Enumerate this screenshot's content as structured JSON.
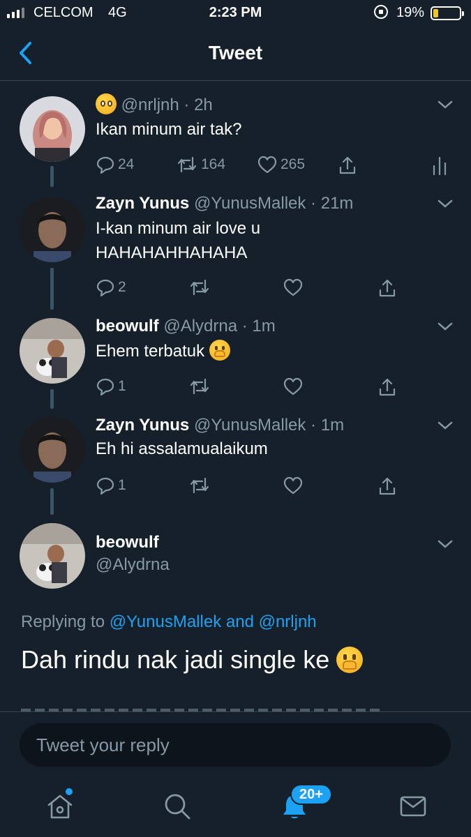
{
  "status_bar": {
    "carrier": "CELCOM",
    "network": "4G",
    "time": "2:23 PM",
    "battery": "19%",
    "battery_level": 0.19
  },
  "nav": {
    "title": "Tweet",
    "back_icon": "chevron-left-icon"
  },
  "tweets": [
    {
      "name": "",
      "handle_emoji": "pleading-face-emoji",
      "handle": "@nrljnh",
      "time": "2h",
      "text": "Ikan minum air tak?",
      "replies": "24",
      "retweets": "164",
      "likes": "265"
    },
    {
      "name": "Zayn Yunus",
      "handle": "@YunusMallek",
      "time": "21m",
      "text_line1": "I-kan minum air love u",
      "text_line2": "HAHAHAHHAHAHA",
      "replies": "2"
    },
    {
      "name": "beowulf",
      "handle": "@Alydrna",
      "time": "1m",
      "text": "Ehem terbatuk",
      "text_emoji": "face-with-hand-over-mouth-emoji",
      "replies": "1"
    },
    {
      "name": "Zayn Yunus",
      "handle": "@YunusMallek",
      "time": "1m",
      "text": "Eh hi assalamualaikum",
      "replies": "1"
    }
  ],
  "main_tweet": {
    "name": "beowulf",
    "handle": "@Alydrna",
    "replying_prefix": "Replying to",
    "reply_user1": "@YunusMallek",
    "reply_and": "and",
    "reply_user2": "@nrljnh",
    "text": "Dah rindu nak jadi single ke",
    "text_emoji": "face-with-hand-over-mouth-emoji"
  },
  "reply_bar": {
    "placeholder": "Tweet your reply"
  },
  "tab_bar": {
    "notifications_badge": "20+",
    "tabs": [
      "home-icon",
      "search-icon",
      "notifications-icon",
      "messages-icon"
    ]
  },
  "colors": {
    "background": "#15202b",
    "accent": "#1da1f2",
    "secondary_text": "#8899a6",
    "divider": "#38444d"
  }
}
